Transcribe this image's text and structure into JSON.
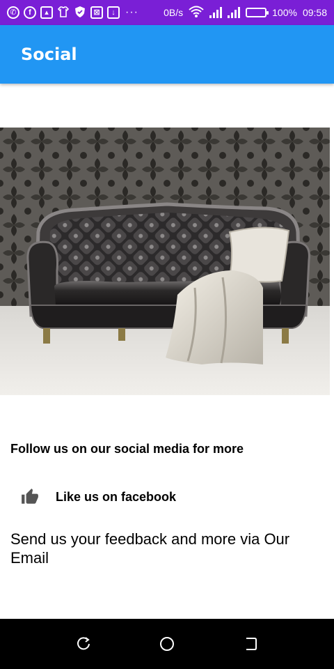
{
  "status_bar": {
    "network_speed": "0B/s",
    "battery": "100%",
    "battery_level": 1.0,
    "time": "09:58",
    "notification_icons": [
      "whatsapp-icon",
      "facebook-icon",
      "clipboard-icon",
      "shirt-icon",
      "shield-icon",
      "image-icon",
      "download-icon"
    ]
  },
  "app_bar": {
    "title": "Social",
    "color": "#2196f3"
  },
  "hero": {
    "description_icon": "sofa-image"
  },
  "content": {
    "follow_text": "Follow us on our social media for more",
    "facebook_label": "Like us on facebook",
    "facebook_icon": "thumbs-up-icon",
    "feedback_text": "Send us your feedback and more via Our Email"
  },
  "nav_bar": {
    "buttons": [
      "back-icon",
      "home-icon",
      "recents-icon"
    ]
  }
}
